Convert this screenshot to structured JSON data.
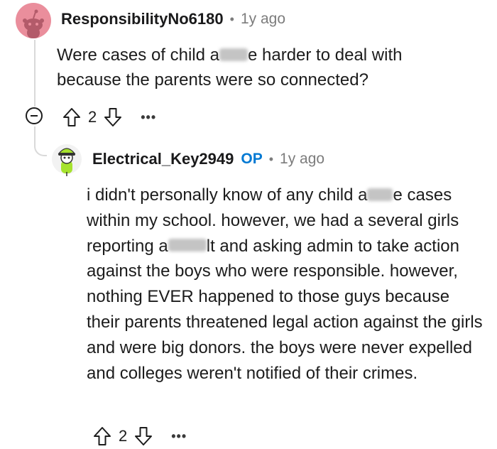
{
  "parent_comment": {
    "username": "ResponsibilityNo6180",
    "time": "1y ago",
    "text_part1": "Were cases of child a",
    "text_part2": "e harder to deal with because the parents were so connected?",
    "vote_count": "2"
  },
  "reply_comment": {
    "username": "Electrical_Key2949",
    "op_badge": "OP",
    "time": "1y ago",
    "text_part1": "i didn't personally know of any child a",
    "text_part2": "e cases within my school. however, we had a several girls reporting a",
    "text_part3": "lt and asking admin to take action against the boys who were responsible. however, nothing EVER happened to those guys because their parents threatened legal action against the girls and were big donors. the boys were never expelled and colleges weren't notified of their crimes.",
    "vote_count": "2"
  },
  "icons": {
    "separator": "dot-separator",
    "upvote": "upvote-arrow-icon",
    "downvote": "downvote-arrow-icon",
    "more": "more-options-icon",
    "collapse": "collapse-thread-icon"
  },
  "colors": {
    "op_badge": "#0079d3",
    "meta_text": "#7c7c7c",
    "avatar1_bg": "#ea8e9c",
    "avatar2_accent": "#a6e22e"
  }
}
